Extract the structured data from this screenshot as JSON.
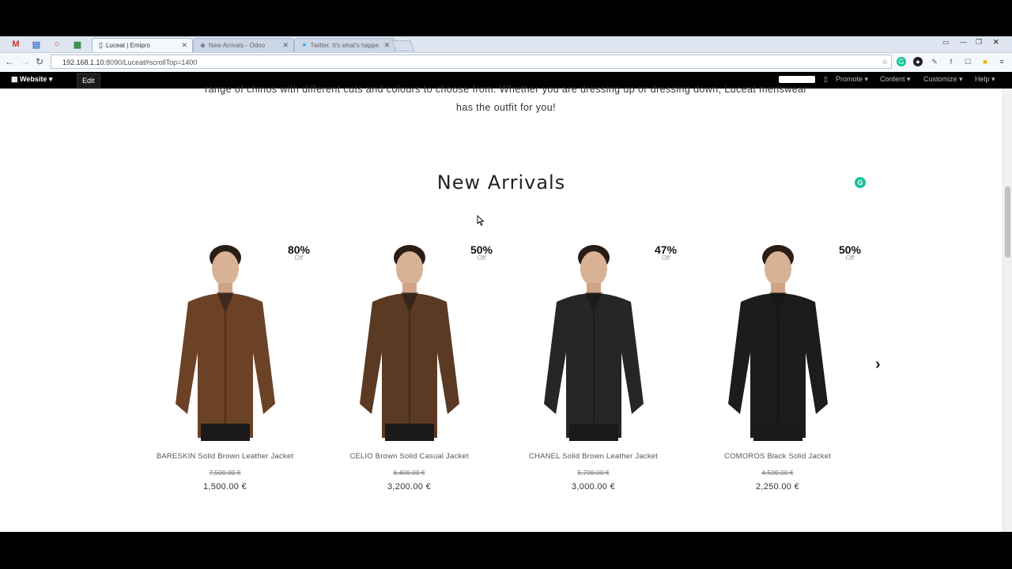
{
  "browser": {
    "tabs": [
      {
        "label": "Luceat | Emipro",
        "active": true
      },
      {
        "label": "New Arrivals - Odoo",
        "active": false
      },
      {
        "label": "Twitter. It's what's happe",
        "active": false
      }
    ],
    "url_host": "192.168.1.10",
    "url_rest": ":8090/Luceat#scrollTop=1400"
  },
  "odoo_bar": {
    "website_label": "Website",
    "edit_label": "Edit",
    "menus": [
      "Promote",
      "Content",
      "Customize",
      "Help"
    ]
  },
  "intro": {
    "line1": "range of chinos with different cuts and colours to choose from. Whether you are dressing up or dressing down, Luceat menswear",
    "line2": "has the outfit for you!"
  },
  "section_title": "New Arrivals",
  "discount_off_label": "Off",
  "products": [
    {
      "name": "BARESKIN Solid Brown Leather Jacket",
      "discount": "80%",
      "old_price": "7,500.00 €",
      "price": "1,500.00 €",
      "jacket_color": "#6b4226"
    },
    {
      "name": "CELIO Brown Solid Casual Jacket",
      "discount": "50%",
      "old_price": "6,400.00 €",
      "price": "3,200.00 €",
      "jacket_color": "#5a3a22"
    },
    {
      "name": "CHANEL Solid Brown Leather Jacket",
      "discount": "47%",
      "old_price": "5,700.00 €",
      "price": "3,000.00 €",
      "jacket_color": "#262626"
    },
    {
      "name": "COMOROS Black Solid Jacket",
      "discount": "50%",
      "old_price": "4,500.00 €",
      "price": "2,250.00 €",
      "jacket_color": "#1c1c1c"
    }
  ],
  "colors": {
    "grammarly": "#15c39a",
    "odoo_bar": "#000000"
  }
}
